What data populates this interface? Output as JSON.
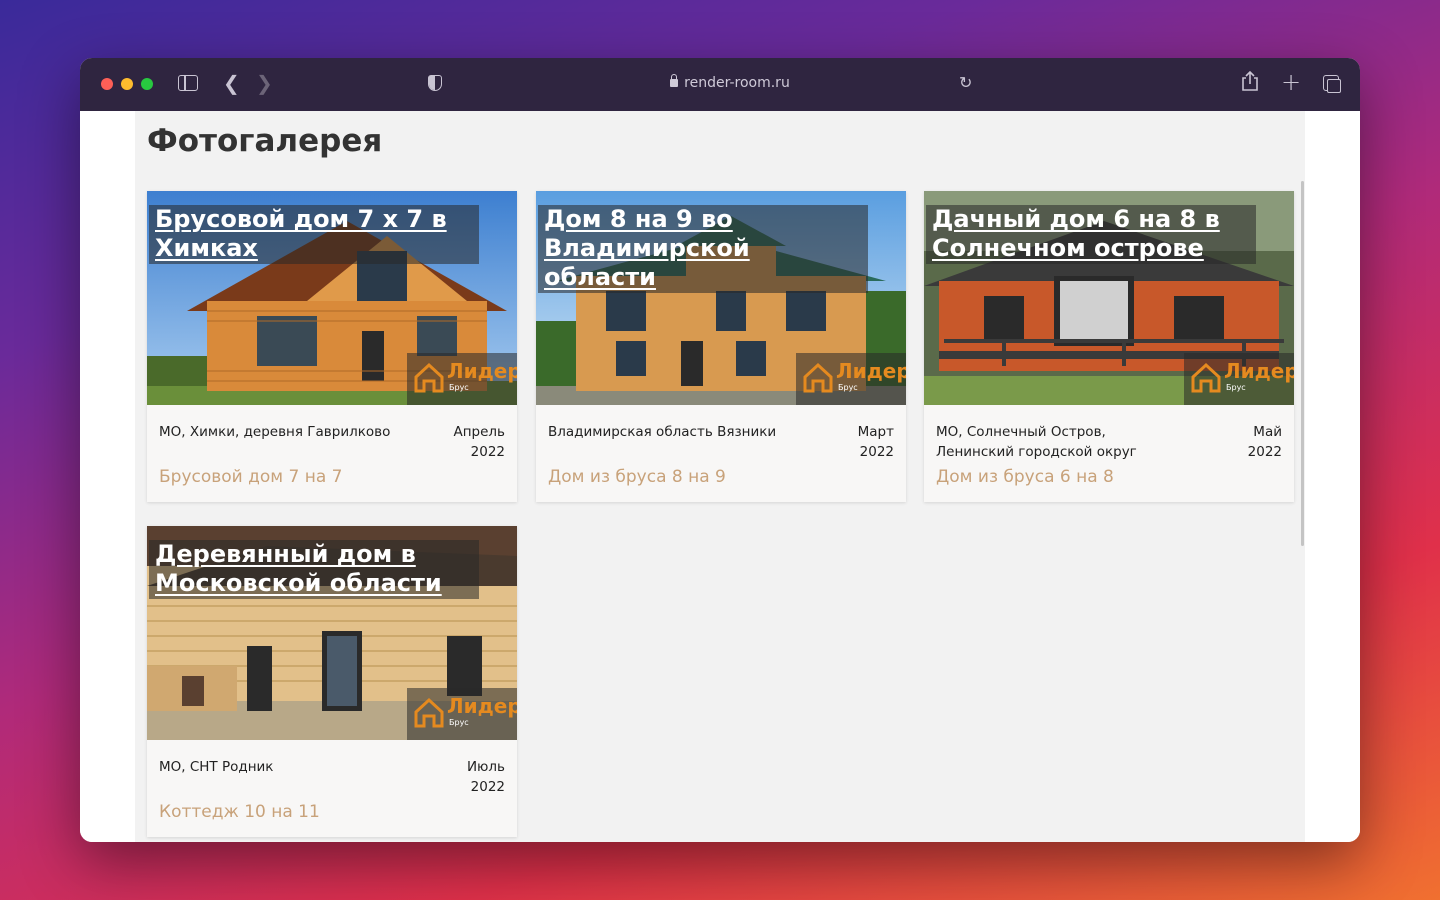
{
  "browser": {
    "address": "render-room.ru"
  },
  "page": {
    "title": "Фотогалерея"
  },
  "brand": {
    "name": "Лидер",
    "sub": "Брус",
    "accent": "#e58a1f"
  },
  "cards": [
    {
      "title": "Брусовой дом 7 х 7 в Химках",
      "location": "МО, Химки, деревня Гаврилково",
      "month": "Апрель",
      "year": "2022",
      "link": "Брусовой дом 7 на 7"
    },
    {
      "title": "Дом 8 на 9 во Владимирской области",
      "location": "Владимирская область Вязники",
      "month": "Март",
      "year": "2022",
      "link": "Дом из бруса 8 на 9"
    },
    {
      "title": "Дачный дом 6 на 8 в Солнечном острове",
      "location": "МО, Солнечный Остров, Ленинский городской округ",
      "month": "Май",
      "year": "2022",
      "link": "Дом из бруса 6 на 8"
    },
    {
      "title": "Деревянный дом в Московской области",
      "location": "МО, СНТ Родник",
      "month": "Июль",
      "year": "2022",
      "link": "Коттедж 10 на 11"
    }
  ]
}
